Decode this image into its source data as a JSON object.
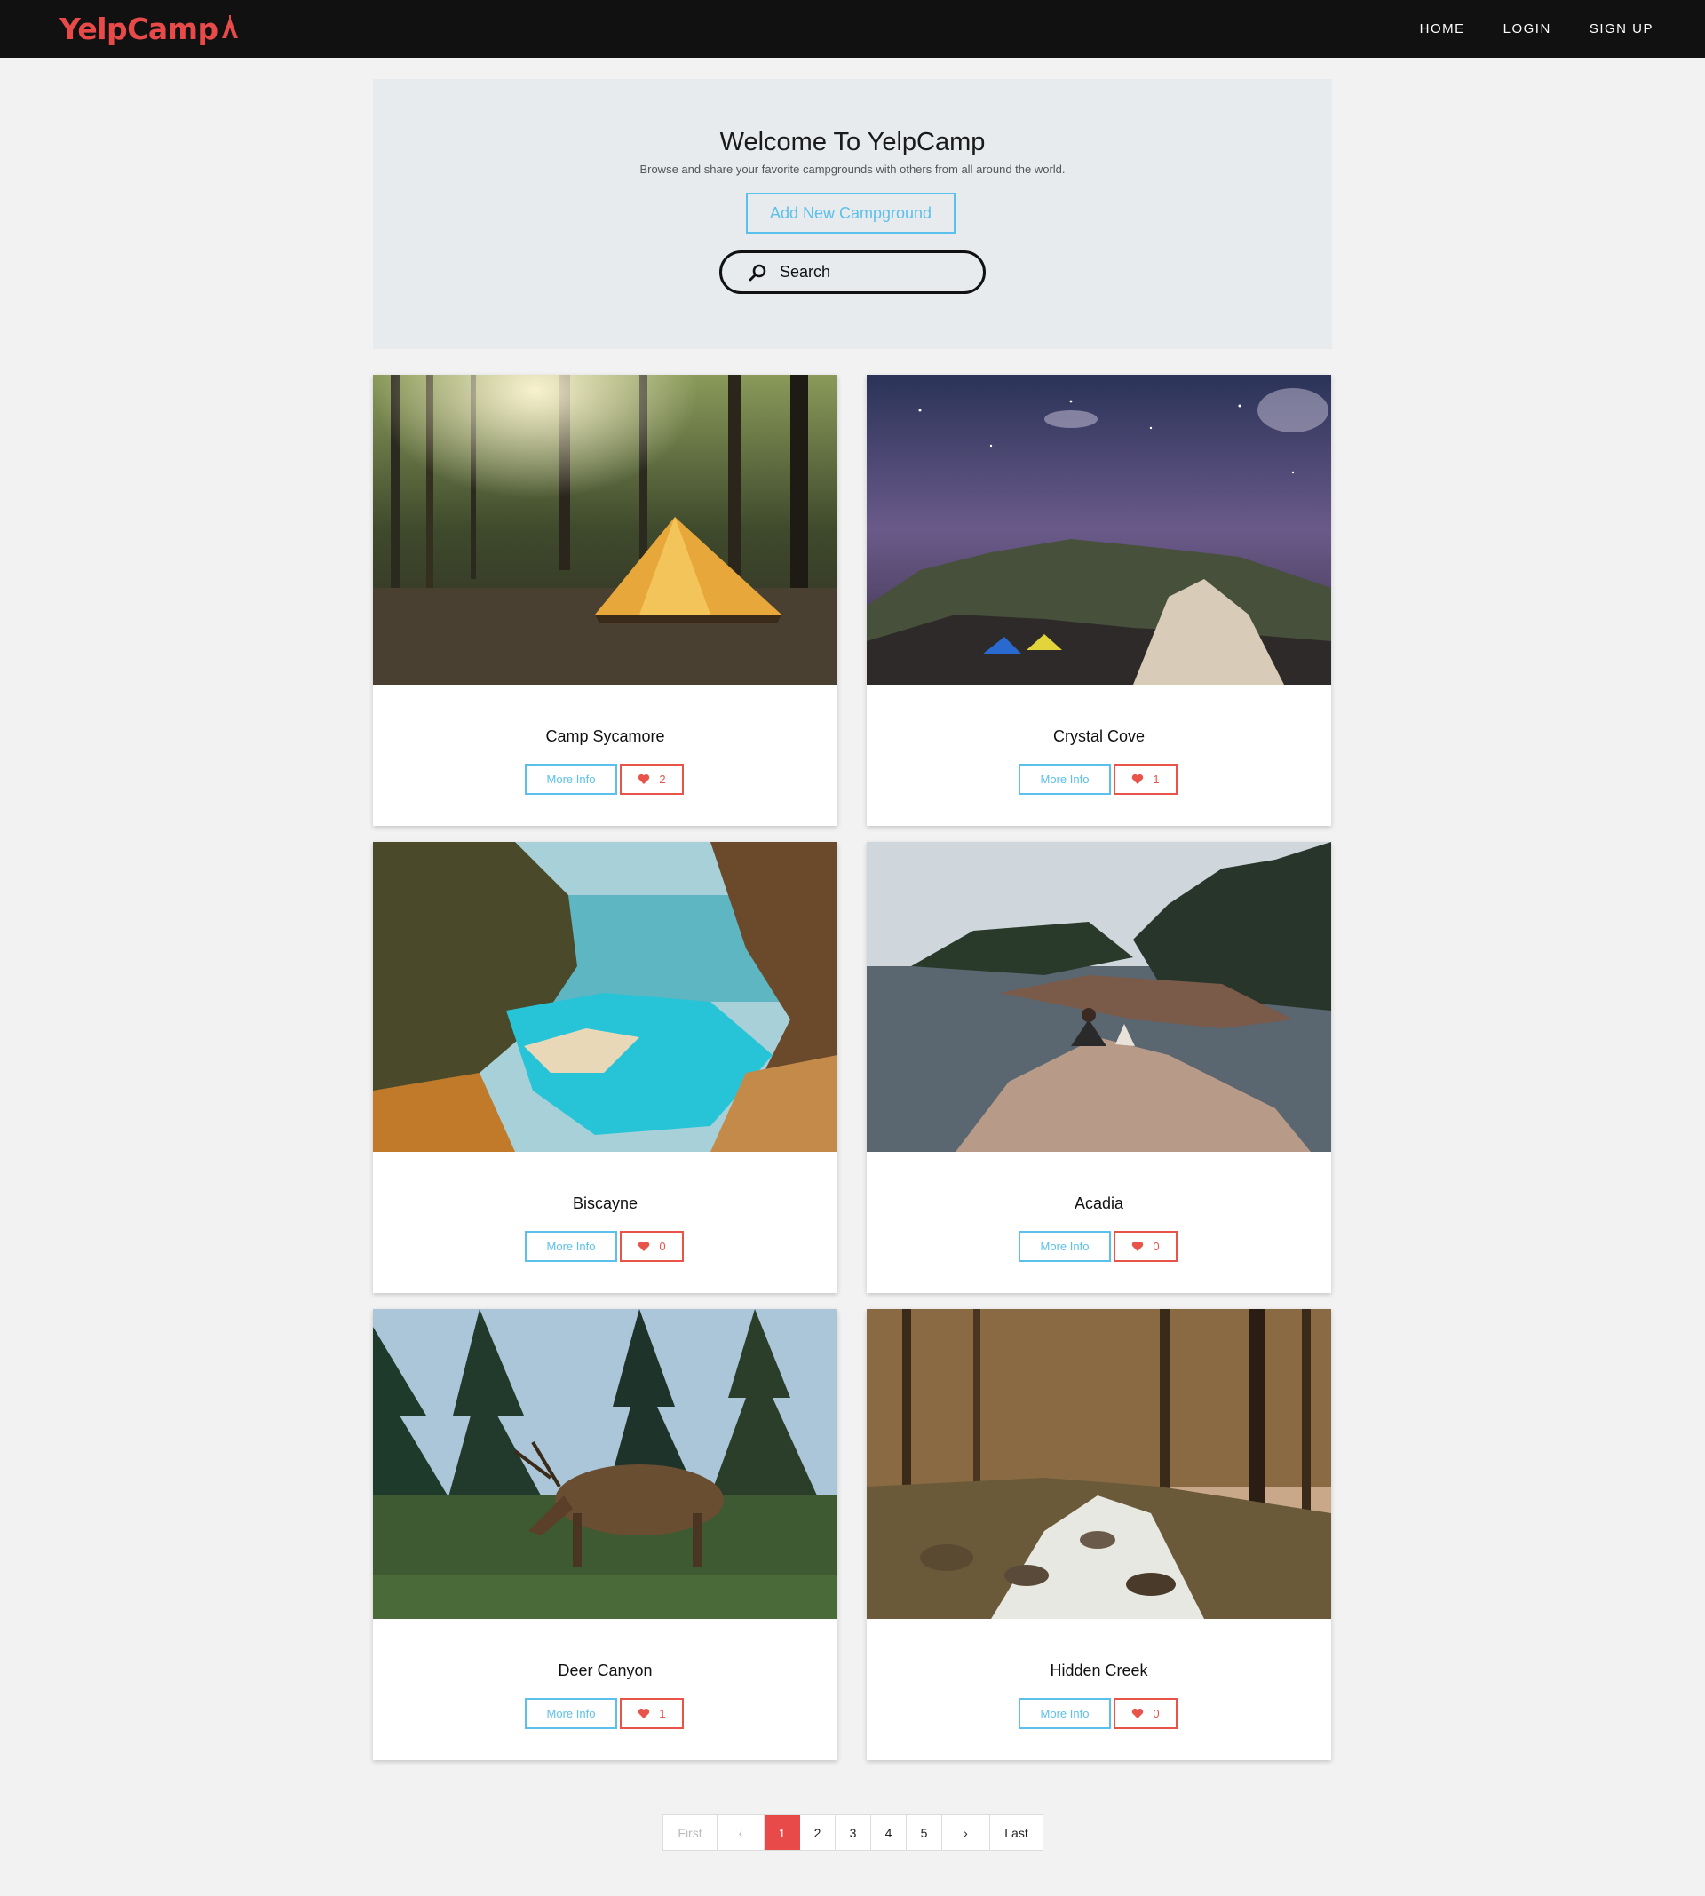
{
  "nav": {
    "brand": "YelpCamp",
    "links": [
      "HOME",
      "LOGIN",
      "SIGN UP"
    ]
  },
  "jumbotron": {
    "title": "Welcome To YelpCamp",
    "subtitle": "Browse and share your favorite campgrounds with others from all around the world.",
    "add_button": "Add New Campground",
    "search_placeholder": "Search"
  },
  "campgrounds": [
    {
      "name": "Camp Sycamore",
      "more_label": "More Info",
      "likes": "2"
    },
    {
      "name": "Crystal Cove",
      "more_label": "More Info",
      "likes": "1"
    },
    {
      "name": "Biscayne",
      "more_label": "More Info",
      "likes": "0"
    },
    {
      "name": "Acadia",
      "more_label": "More Info",
      "likes": "0"
    },
    {
      "name": "Deer Canyon",
      "more_label": "More Info",
      "likes": "1"
    },
    {
      "name": "Hidden Creek",
      "more_label": "More Info",
      "likes": "0"
    }
  ],
  "pagination": {
    "first": "First",
    "prev": "‹",
    "pages": [
      "1",
      "2",
      "3",
      "4",
      "5"
    ],
    "next": "›",
    "last": "Last",
    "current": "1"
  },
  "colors": {
    "brand": "#e84a4a",
    "accent_blue": "#5bc0eb",
    "like_red": "#e8534a",
    "navbar": "#111111"
  }
}
